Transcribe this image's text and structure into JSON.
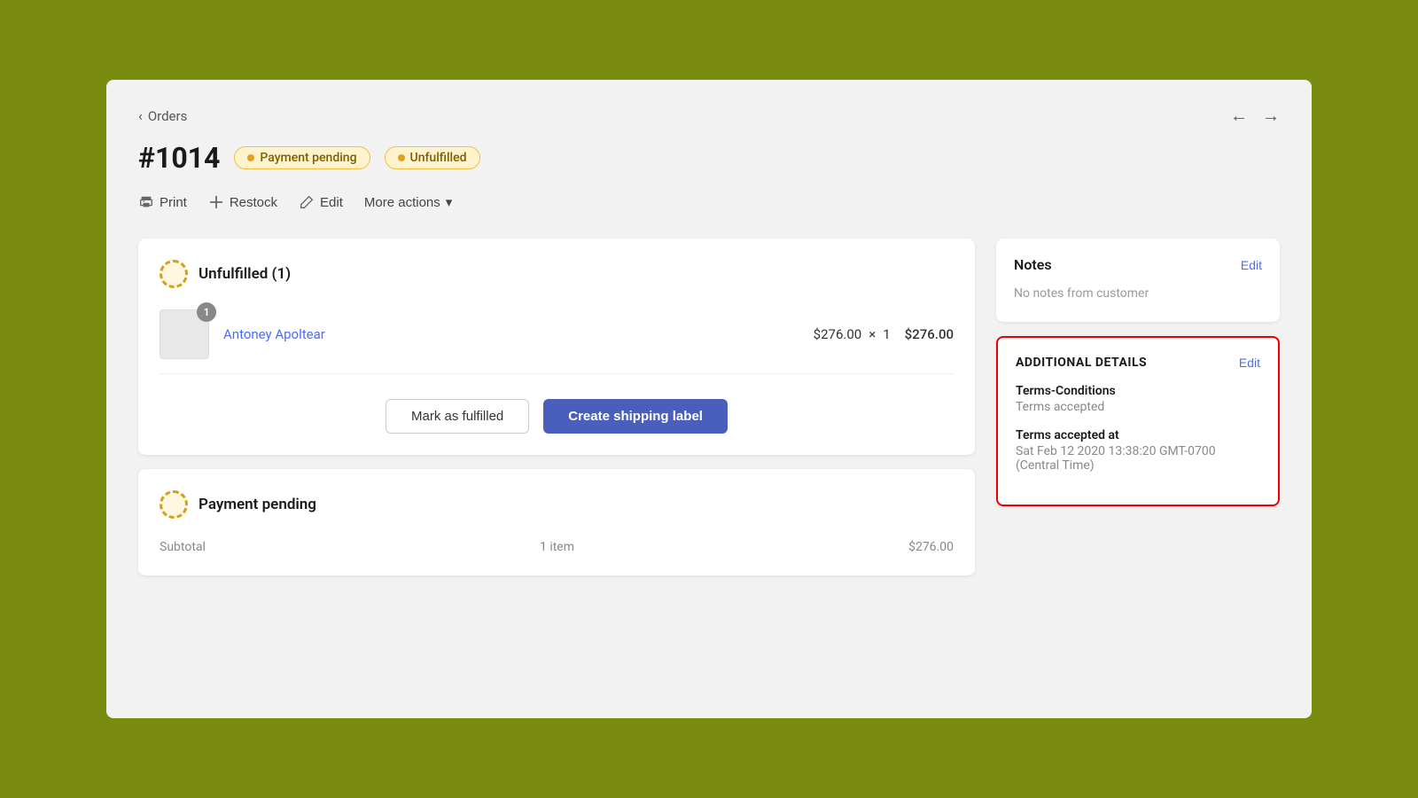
{
  "nav": {
    "back_label": "Orders",
    "arrow_left": "←",
    "arrow_right": "→"
  },
  "header": {
    "order_number": "#1014",
    "badge_payment": "Payment pending",
    "badge_unfulfilled": "Unfulfilled"
  },
  "toolbar": {
    "print_label": "Print",
    "restock_label": "Restock",
    "edit_label": "Edit",
    "more_actions_label": "More actions"
  },
  "unfulfilled_card": {
    "title": "Unfulfilled (1)",
    "product_name": "Antoney Apoltear",
    "product_quantity": "1",
    "product_price": "$276.00",
    "price_separator": "×",
    "product_total": "$276.00",
    "mark_fulfilled_label": "Mark as fulfilled",
    "create_label_label": "Create shipping label"
  },
  "payment_card": {
    "title": "Payment pending",
    "subtotal_label": "Subtotal",
    "subtotal_items": "1 item",
    "subtotal_value": "$276.00"
  },
  "notes_card": {
    "title": "Notes",
    "edit_label": "Edit",
    "no_notes_text": "No notes from customer"
  },
  "additional_card": {
    "title": "ADDITIONAL DETAILS",
    "edit_label": "Edit",
    "terms_label": "Terms-Conditions",
    "terms_value": "Terms accepted",
    "accepted_at_label": "Terms accepted at",
    "accepted_at_value": "Sat Feb 12 2020 13:38:20 GMT-0700 (Central Time)"
  }
}
